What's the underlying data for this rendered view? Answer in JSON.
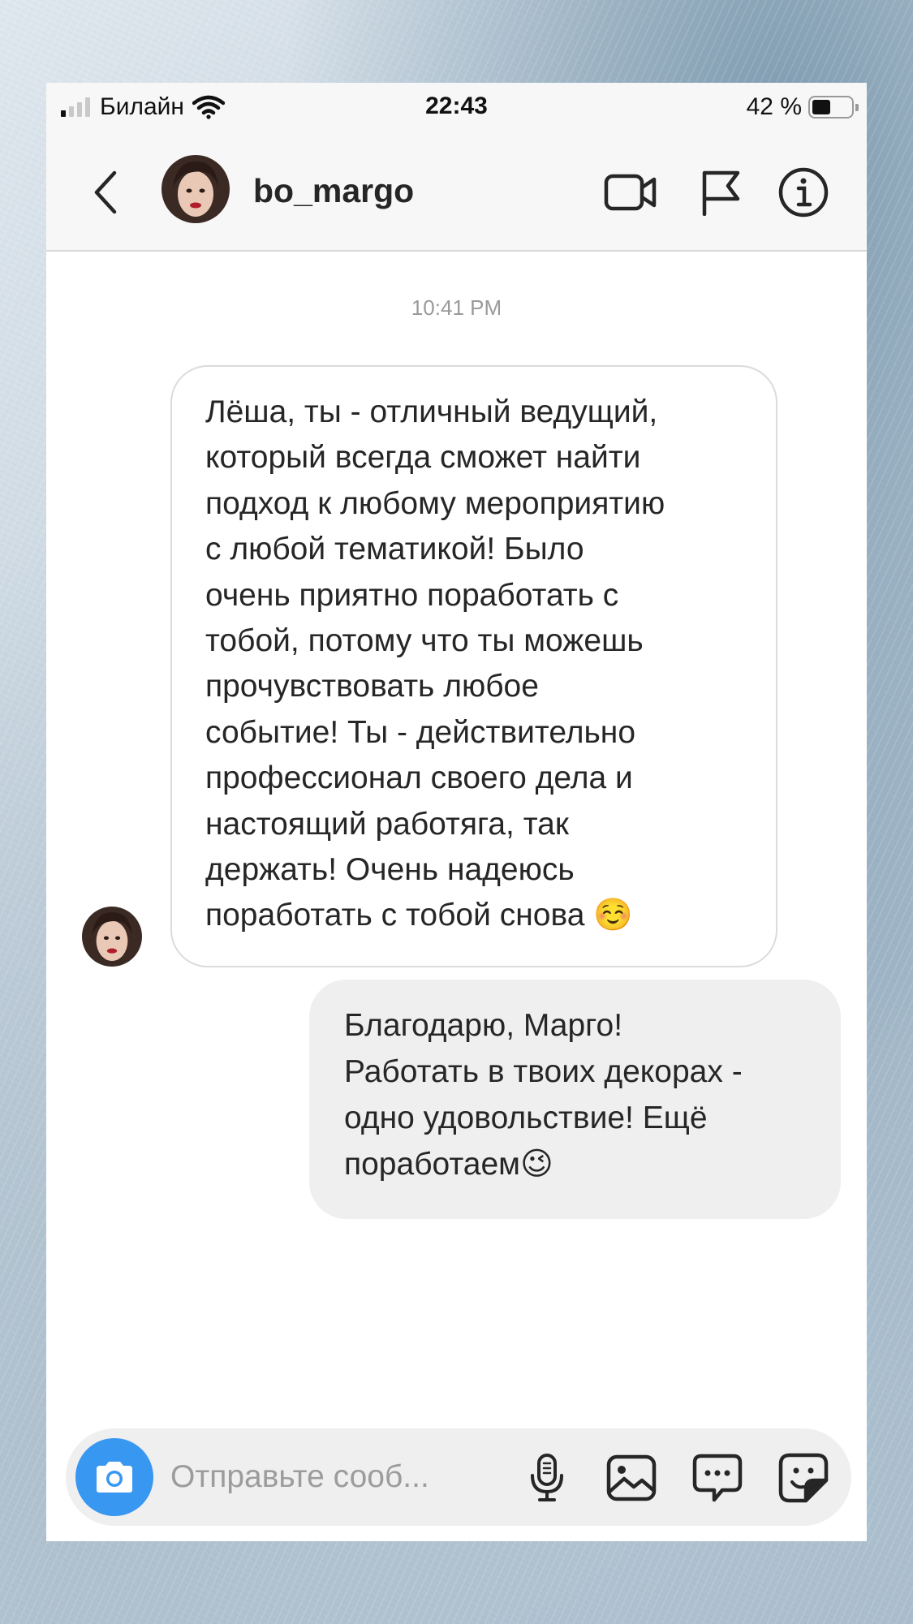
{
  "status_bar": {
    "carrier": "Билайн",
    "time": "22:43",
    "battery_percent_text": "42 %",
    "battery_level": 0.42,
    "signal_bars_active": 1,
    "signal_bars_total": 4
  },
  "header": {
    "username": "bo_margo",
    "icons": [
      "back-arrow-icon",
      "avatar",
      "video-camera-icon",
      "flag-icon",
      "info-icon"
    ]
  },
  "conversation": {
    "timestamp": "10:41 PM",
    "messages": [
      {
        "direction": "received",
        "text": "Лёша, ты - отличный ведущий,\nкоторый всегда сможет найти\nподход к любому мероприятию\nс любой тематикой! Было\nочень приятно поработать с\nтобой, потому что ты можешь\nпрочувствовать любое\nсобытие! Ты - действительно\nпрофессионал своего дела и\nнастоящий работяга, так\nдержать! Очень надеюсь\nпоработать с тобой снова ☺️"
      },
      {
        "direction": "sent",
        "text": "Благодарю, Марго!\nРаботать в твоих декорах -\nодно удовольствие! Ещё\nпоработаем😉"
      }
    ]
  },
  "composer": {
    "placeholder": "Отправьте сооб...",
    "value": "",
    "icons": [
      "camera-icon",
      "microphone-icon",
      "gallery-icon",
      "chat-bubble-icon",
      "sticker-icon"
    ]
  },
  "colors": {
    "accent": "#3897f0",
    "bubble_sent": "#efefef",
    "bubble_border": "#dbdbdb",
    "text": "#262626",
    "muted": "#9a9a9a"
  }
}
